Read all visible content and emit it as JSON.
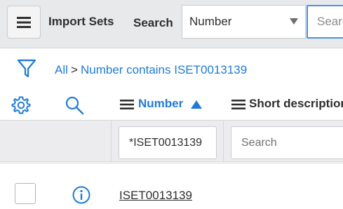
{
  "header": {
    "menu_icon": "hamburger-menu-icon",
    "list_title": "Import Sets",
    "search_label": "Search",
    "search_field_selected": "Number",
    "search_placeholder": "Search"
  },
  "breadcrumb": {
    "filter_icon": "funnel-filter-icon",
    "all_label": "All",
    "separator": ">",
    "condition": "Number contains ISET0013139"
  },
  "columns": {
    "settings_icon": "gear-icon",
    "search_icon": "magnifier-icon",
    "number_label": "Number",
    "number_sort": "ascending",
    "short_description_label": "Short description"
  },
  "filters": {
    "number_value": "*ISET0013139",
    "short_description_placeholder": "Search"
  },
  "rows": [
    {
      "info_icon": "info-icon",
      "number": "ISET0013139"
    }
  ],
  "colors": {
    "accent": "#1f7bd6",
    "topbar": "#e8e9eb",
    "focus_border": "#4a90e2"
  }
}
